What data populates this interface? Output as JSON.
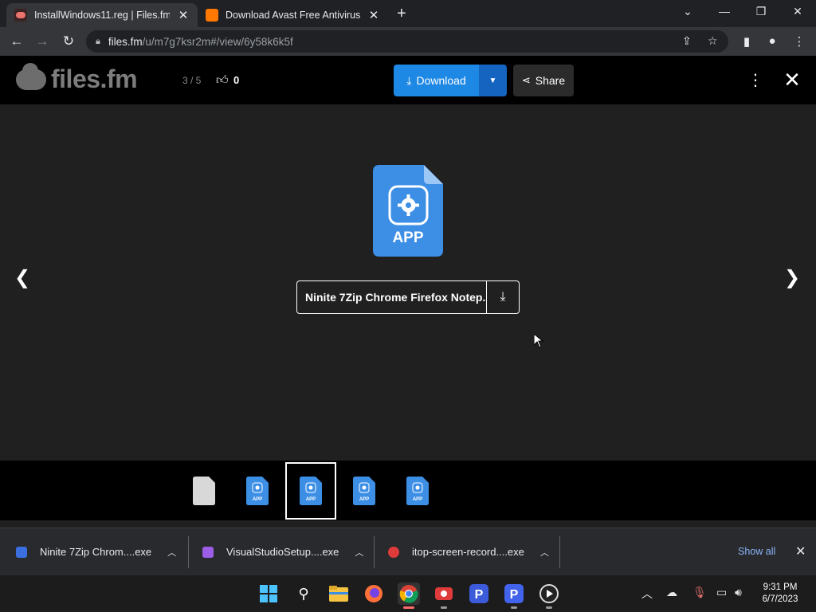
{
  "browser": {
    "tabs": [
      {
        "title": "InstallWindows11.reg | Files.fm.",
        "active": true
      },
      {
        "title": "Download Avast Free Antivirus - ",
        "active": false
      }
    ],
    "url_host": "files.fm",
    "url_path": "/u/m7g7ksr2m#/view/6y58k6k5f"
  },
  "header": {
    "logo_text": "files.fm",
    "counter": "3 / 5",
    "like_count": "0",
    "download_label": "Download",
    "share_label": "Share"
  },
  "viewer": {
    "file_type": "APP",
    "file_name": "Ninite 7Zip Chrome Firefox Notep...",
    "accent": "#3d8fe6"
  },
  "thumbnails": [
    {
      "type": "generic",
      "label": ""
    },
    {
      "type": "app",
      "label": "APP"
    },
    {
      "type": "app",
      "label": "APP",
      "selected": true
    },
    {
      "type": "app",
      "label": "APP"
    },
    {
      "type": "app",
      "label": "APP"
    }
  ],
  "downloads": {
    "items": [
      {
        "name": "Ninite 7Zip Chrom....exe",
        "color": "#3b6fe0"
      },
      {
        "name": "VisualStudioSetup....exe",
        "color": "#9b5de5"
      },
      {
        "name": "itop-screen-record....exe",
        "color": "#e03b3b"
      }
    ],
    "show_all": "Show all"
  },
  "taskbar": {
    "time": "9:31 PM",
    "date": "6/7/2023"
  }
}
